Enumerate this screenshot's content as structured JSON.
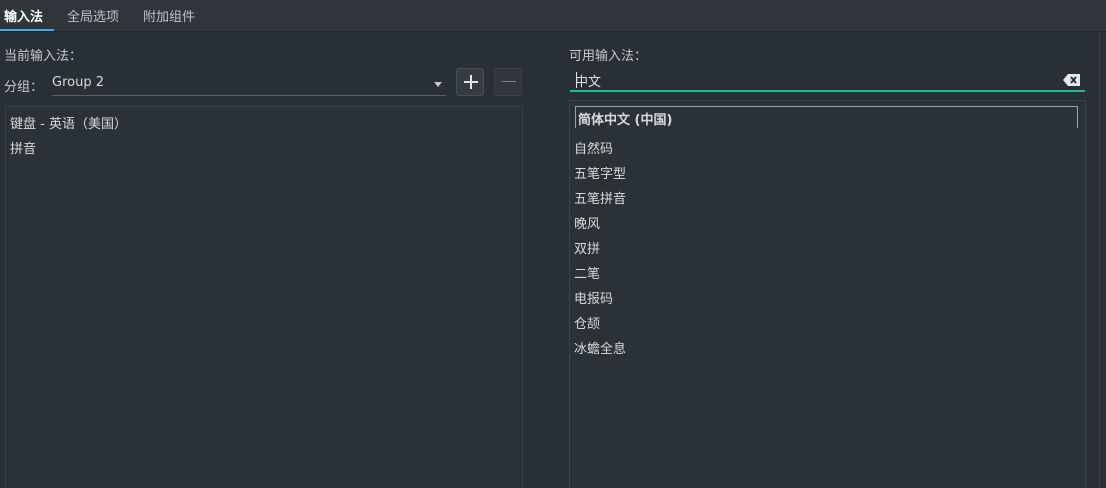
{
  "tabs": [
    {
      "label": "输入法",
      "active": true
    },
    {
      "label": "全局选项",
      "active": false
    },
    {
      "label": "附加组件",
      "active": false
    }
  ],
  "left": {
    "title": "当前输入法：",
    "group_label": "分组：",
    "group_value": "Group 2",
    "add_icon": "plus-icon",
    "remove_icon": "minus-icon",
    "items": [
      "键盘 - 英语（美国）",
      "拼音"
    ]
  },
  "right": {
    "title": "可用输入法：",
    "search_value": "中文",
    "clear_icon": "backspace-clear-icon",
    "group_header": "简体中文 (中国)",
    "items": [
      "自然码",
      "五笔字型",
      "五笔拼音",
      "晚风",
      "双拼",
      "二笔",
      "电报码",
      "仓颉",
      "冰蟾全息"
    ]
  },
  "colors": {
    "accent": "#3daee9",
    "search_underline": "#1abc9c",
    "background": "#283035"
  }
}
